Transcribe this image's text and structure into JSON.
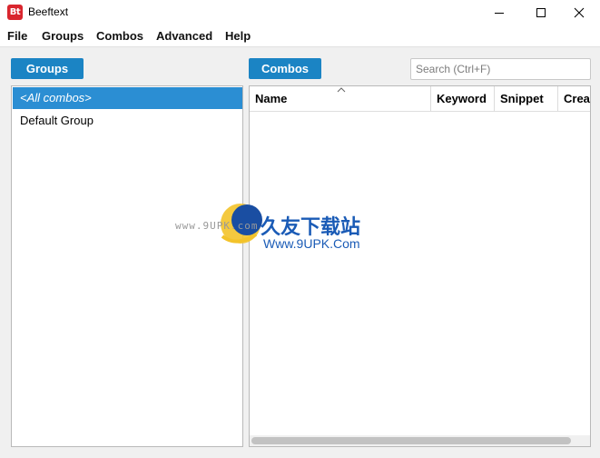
{
  "window": {
    "title": "Beeftext",
    "icon_text": "Bt"
  },
  "menu": {
    "items": [
      "File",
      "Groups",
      "Combos",
      "Advanced",
      "Help"
    ]
  },
  "groups": {
    "button_label": "Groups",
    "items": [
      {
        "label": "<All combos>",
        "selected": true
      },
      {
        "label": "Default Group",
        "selected": false
      }
    ]
  },
  "combos": {
    "button_label": "Combos",
    "columns": [
      "Name",
      "Keyword",
      "Snippet",
      "Creat"
    ],
    "rows": []
  },
  "search": {
    "placeholder": "Search (Ctrl+F)",
    "value": ""
  },
  "watermark": {
    "small_text": "www.9UPK.com",
    "cn_text": "久友下载站",
    "url_text": "Www.9UPK.Com"
  },
  "colors": {
    "accent": "#1b84c4",
    "selection": "#2b8ed3",
    "brand_icon": "#d9262e"
  }
}
